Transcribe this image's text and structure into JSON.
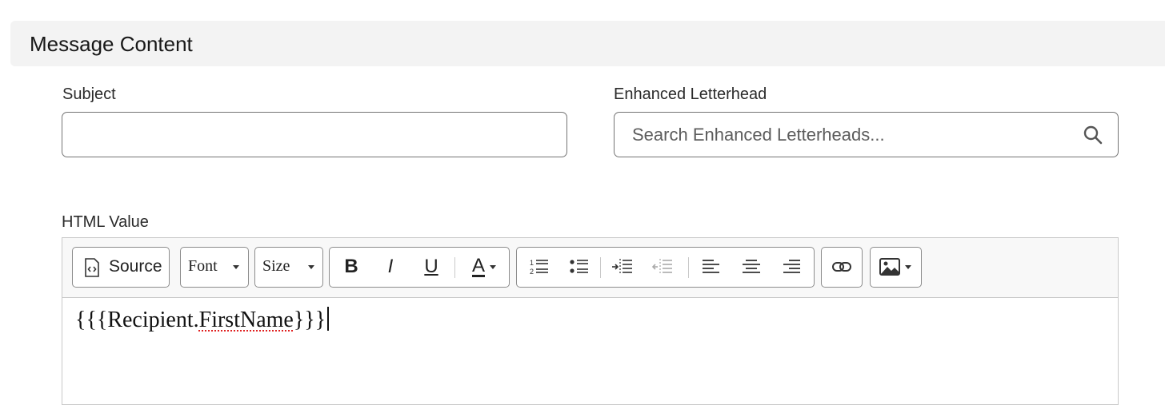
{
  "section": {
    "title": "Message Content"
  },
  "subject": {
    "label": "Subject",
    "value": ""
  },
  "letterhead": {
    "label": "Enhanced Letterhead",
    "placeholder": "Search Enhanced Letterheads..."
  },
  "html_value": {
    "label": "HTML Value",
    "toolbar": {
      "source_label": "Source",
      "font_label": "Font",
      "size_label": "Size",
      "bold_label": "B",
      "italic_label": "I",
      "underline_label": "U",
      "text_color_label": "A"
    },
    "content": {
      "prefix": "{{{Recipient.",
      "misspelled": "FirstName",
      "suffix": "}}}"
    }
  }
}
